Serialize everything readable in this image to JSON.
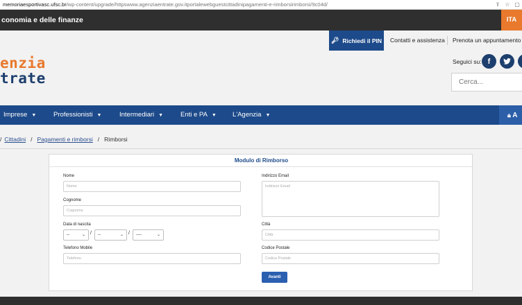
{
  "browser": {
    "url_host": "memoriaesportivasc.ufsc.br",
    "url_path": "/wp-content/upgrade/httpswww.agenziaentrate.gov.itportalewebguestcittadinipagamenti-e-rimborsirimborsi/9c04d/"
  },
  "topbar": {
    "brand": "conomia e delle finanze",
    "lang": "ITA"
  },
  "header": {
    "pin_button": "Richiedi il PIN",
    "links": [
      "Contatti e assistenza",
      "Prenota un appuntamento"
    ],
    "logo_line1": "enzia",
    "logo_line2": "trate",
    "follow_label": "Seguici su:",
    "search_placeholder": "Cerca..."
  },
  "nav": {
    "items": [
      "Imprese",
      "Professionisti",
      "Intermediari",
      "Enti e PA",
      "L'Agenzia"
    ],
    "area_label": "A"
  },
  "breadcrumb": {
    "items": [
      "Cittadini",
      "Pagamenti e rimborsi"
    ],
    "current": "Rimborsi"
  },
  "form": {
    "title": "Modulo di Rimborso",
    "nome_label": "Nome",
    "nome_placeholder": "Nome",
    "cognome_label": "Cognome",
    "cognome_placeholder": "Cognome",
    "data_label": "Data di nascita",
    "day_value": "--",
    "month_value": "--",
    "year_value": "----",
    "telefono_label": "Telefono Mobile",
    "telefono_placeholder": "Telefono",
    "email_label": "Indirizzo Email",
    "email_placeholder": "Indirizzo Email",
    "citta_label": "Città",
    "citta_placeholder": "Città",
    "cap_label": "Codice Postale",
    "cap_placeholder": "Codice Postale",
    "submit_label": "Avanti"
  },
  "colors": {
    "brand_blue": "#1d4a8a",
    "accent_orange": "#e8792d",
    "dark_bar": "#2f2f2f"
  }
}
